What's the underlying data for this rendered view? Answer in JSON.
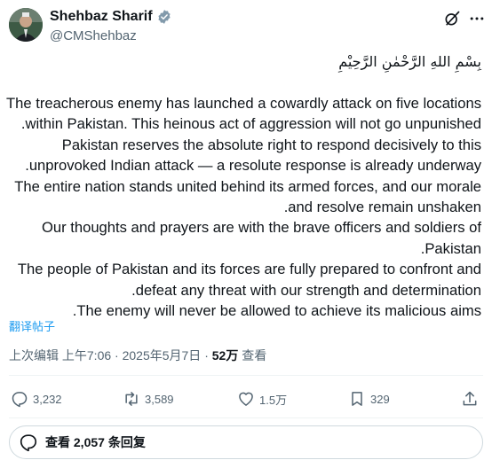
{
  "author": {
    "name": "Shehbaz Sharif",
    "handle": "@CMShehbaz"
  },
  "post": {
    "basmala": "بِسْمِ اللهِ الرَّحْمٰنِ الرَّحِيْمِ",
    "lines": [
      "The treacherous enemy has launched a cowardly attack on five locations",
      ".within Pakistan. This heinous act of aggression will not go unpunished",
      "Pakistan reserves the absolute right to respond decisively to this",
      ".unprovoked Indian attack — a resolute response is already underway",
      "The entire nation stands united behind its armed forces, and our morale",
      ".and resolve remain unshaken",
      "Our thoughts and prayers are with the brave officers and soldiers of",
      ".Pakistan",
      "The people of Pakistan and its forces are fully prepared to confront and",
      ".defeat any threat with our strength and determination",
      ".The enemy will never be allowed to achieve its malicious aims"
    ],
    "translate_label": "翻译帖子"
  },
  "meta": {
    "edited": "上次编辑",
    "time": "上午7:06",
    "sep1": " · ",
    "date": "2025年5月7日",
    "sep2": " · ",
    "views": "52万",
    "views_label": " 查看"
  },
  "actions": {
    "replies": "3,232",
    "reposts": "3,589",
    "likes": "1.5万",
    "bookmarks": "329"
  },
  "replies_button": {
    "label": "查看 2,057 条回复"
  },
  "colors": {
    "accent": "#1d9bf0",
    "secondary_text": "#536471",
    "primary_text": "#0f1419"
  },
  "icons": [
    "verified-badge-icon",
    "grok-icon",
    "more-icon",
    "reply-icon",
    "repost-icon",
    "like-icon",
    "bookmark-icon",
    "share-icon",
    "speech-bubble-icon"
  ]
}
